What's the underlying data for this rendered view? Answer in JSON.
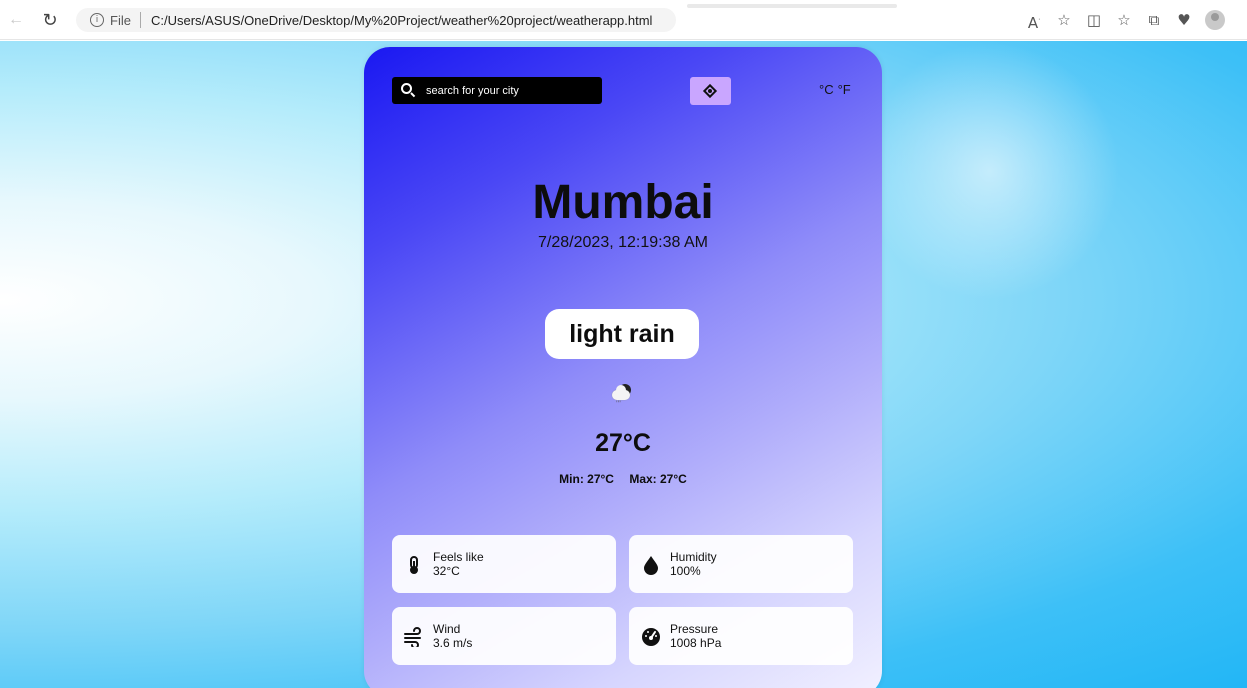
{
  "browser": {
    "file_label": "File",
    "url": "C:/Users/ASUS/OneDrive/Desktop/My%20Project/weather%20project/weatherapp.html",
    "icons": [
      "back-icon",
      "reload-icon",
      "info-icon",
      "read-aloud-icon",
      "favorite-icon",
      "split-screen-icon",
      "favorites-icon",
      "collections-icon",
      "extension-icon",
      "profile-icon"
    ]
  },
  "search": {
    "placeholder": "search for your city"
  },
  "units": {
    "celsius": "°C",
    "fahrenheit": "°F"
  },
  "weather": {
    "city": "Mumbai",
    "datetime": "7/28/2023, 12:19:38 AM",
    "description": "light rain",
    "temperature": "27°C",
    "min": "Min: 27°C",
    "max": "Max: 27°C",
    "icon": "night-rain-cloud-icon"
  },
  "details": {
    "feels_like": {
      "label": "Feels like",
      "value": "32°C",
      "icon": "thermometer-icon"
    },
    "humidity": {
      "label": "Humidity",
      "value": "100%",
      "icon": "droplet-icon"
    },
    "wind": {
      "label": "Wind",
      "value": "3.6 m/s",
      "icon": "wind-icon"
    },
    "pressure": {
      "label": "Pressure",
      "value": "1008 hPa",
      "icon": "gauge-icon"
    }
  },
  "colors": {
    "card_gradient_start": "#1a18f2",
    "card_gradient_end": "#f2f1ff",
    "search_background": "#000000",
    "locate_button": "#c9a6ff",
    "page_background": "#22b6f6"
  }
}
